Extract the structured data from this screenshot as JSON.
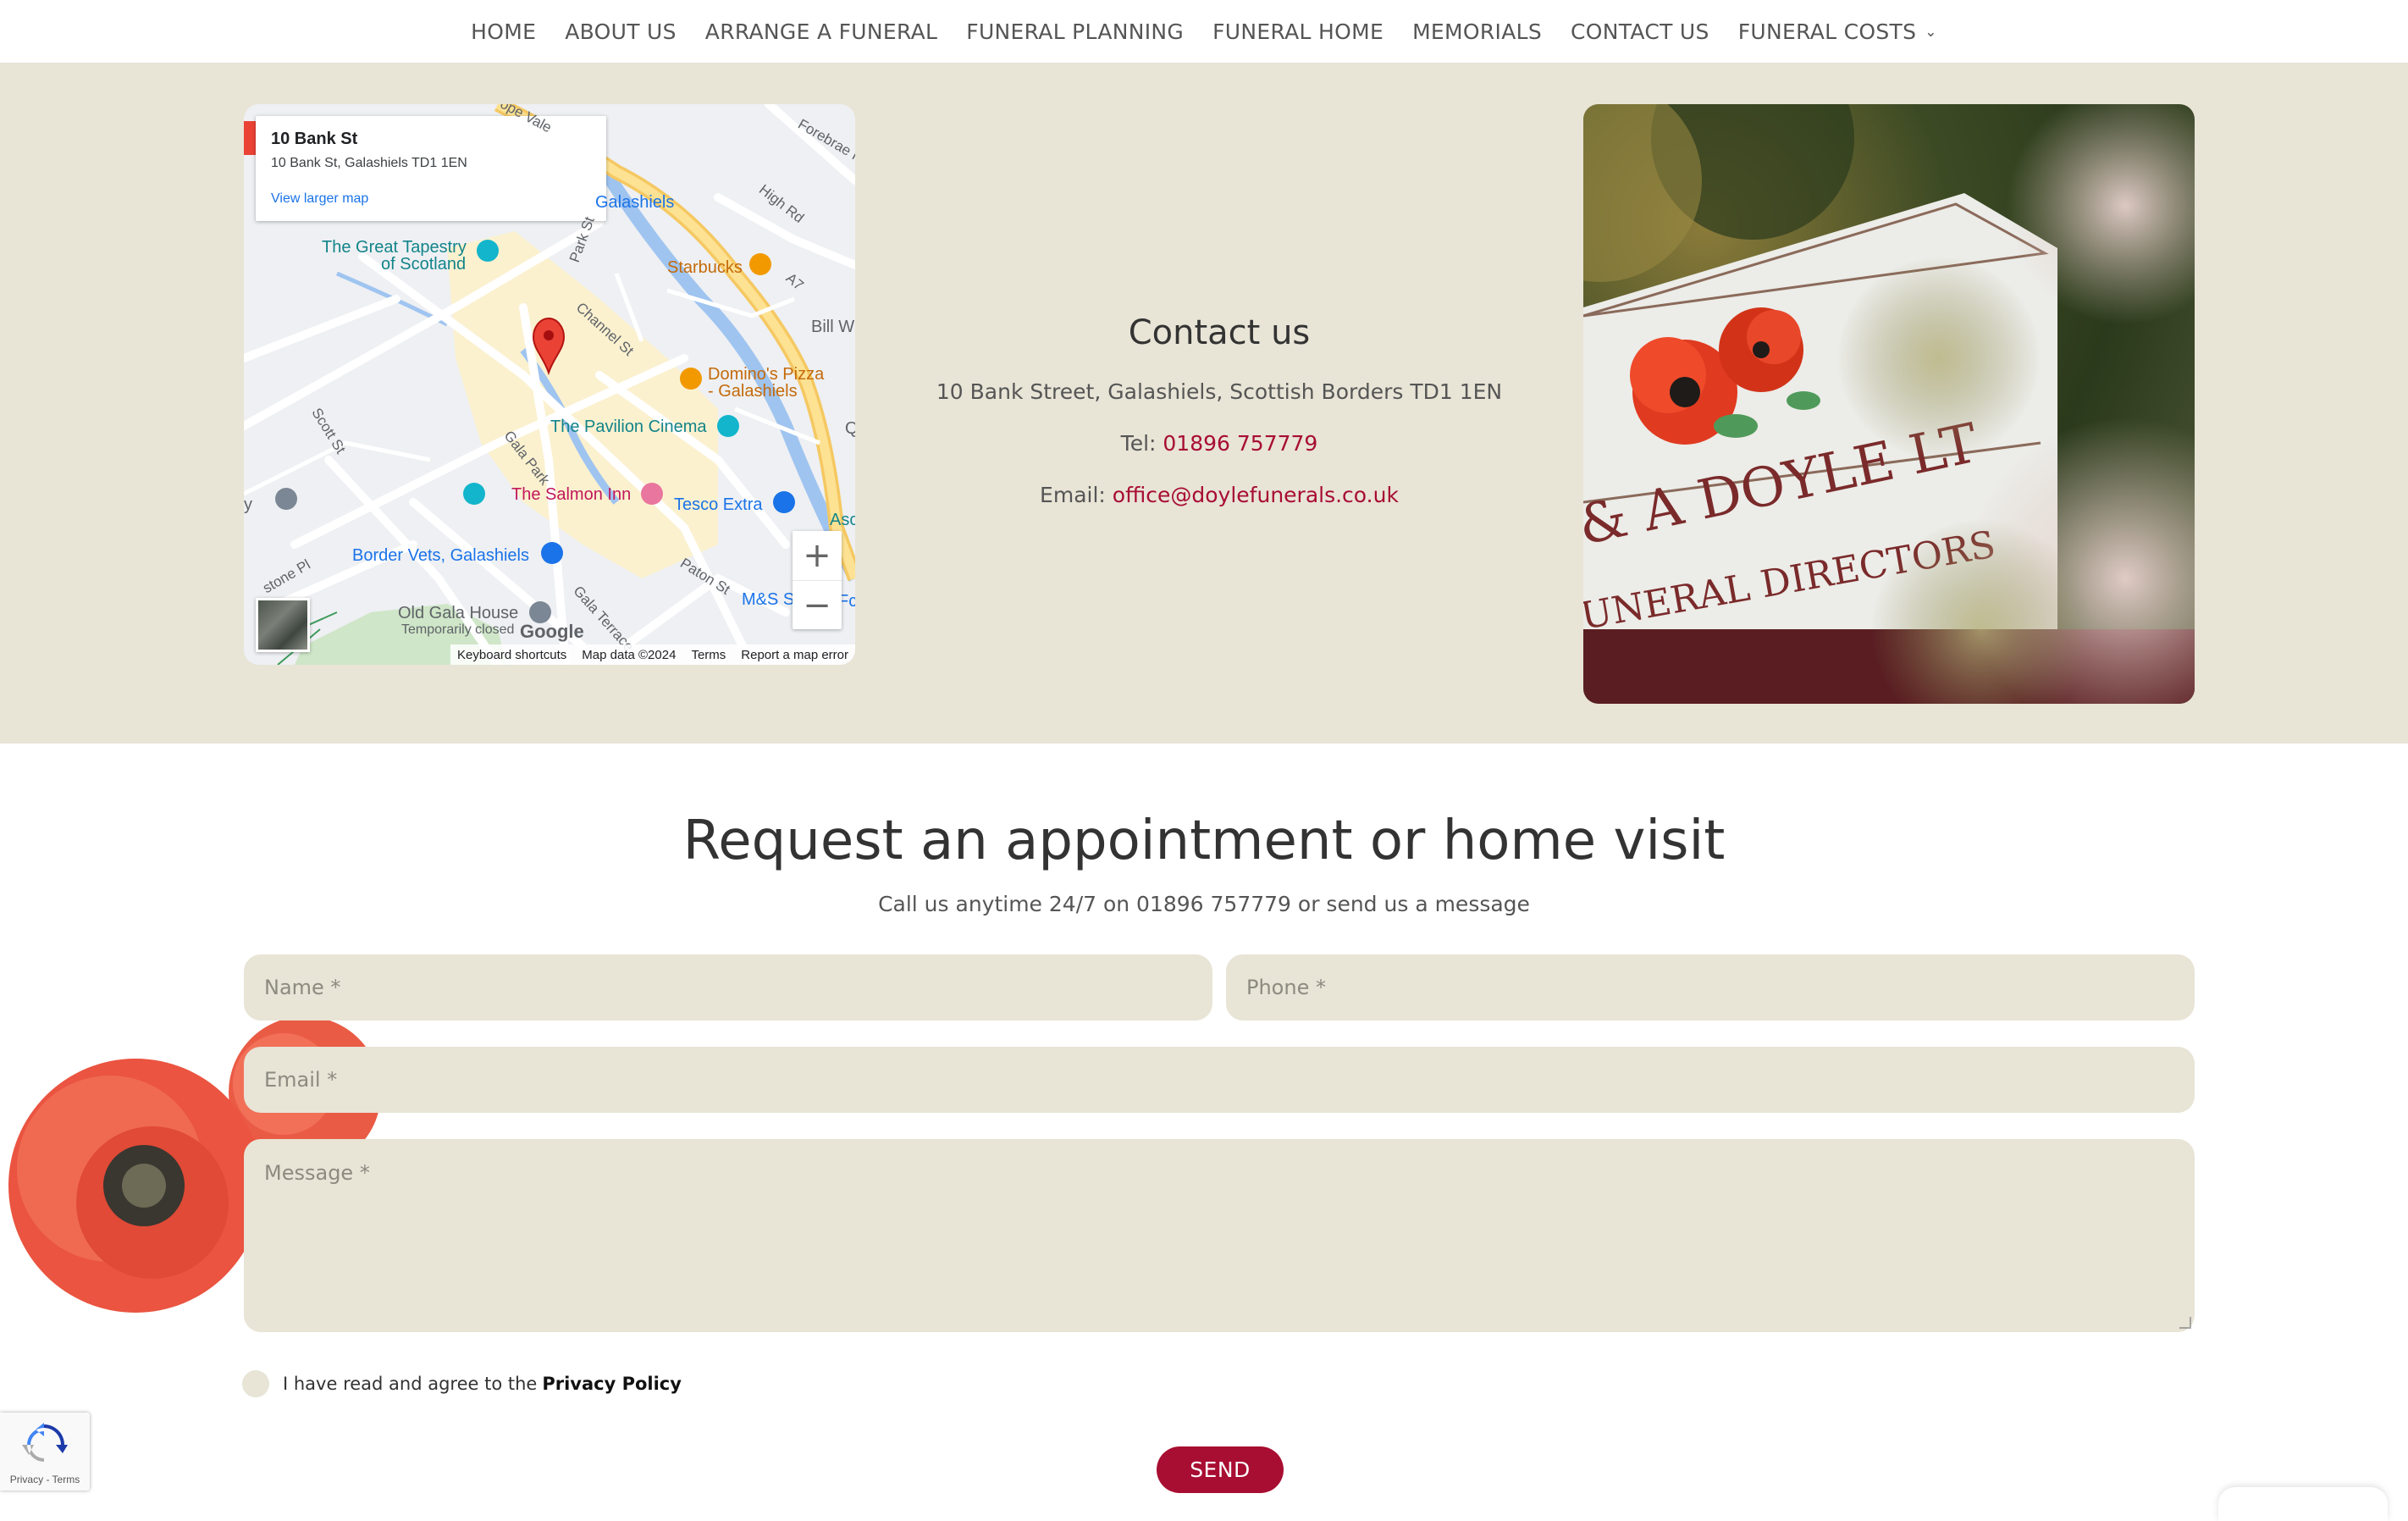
{
  "nav": {
    "items": [
      {
        "label": "HOME"
      },
      {
        "label": "ABOUT US"
      },
      {
        "label": "ARRANGE A FUNERAL"
      },
      {
        "label": "FUNERAL PLANNING"
      },
      {
        "label": "FUNERAL HOME"
      },
      {
        "label": "MEMORIALS"
      },
      {
        "label": "CONTACT US"
      },
      {
        "label": "FUNERAL COSTS"
      }
    ],
    "dropdown_icon": "chevron-down-icon"
  },
  "map": {
    "card": {
      "title": "10 Bank St",
      "address": "10 Bank St, Galashiels TD1 1EN",
      "link": "View larger map"
    },
    "labels": {
      "galashiels": "Galashiels",
      "tapestry_1": "The Great Tapestry",
      "tapestry_2": "of Scotland",
      "starbucks": "Starbucks",
      "dominos_1": "Domino's Pizza",
      "dominos_2": "- Galashiels",
      "pavilion": "The Pavilion Cinema",
      "salmon": "The Salmon Inn",
      "tesco": "Tesco Extra",
      "border_vets": "Border Vets, Galashiels",
      "old_gala_1": "Old Gala House",
      "old_gala_2": "Temporarily closed",
      "ms": "M&S S",
      "bill_w": "Bill W",
      "forebrae": "Forebrae H",
      "high_rd": "High Rd",
      "a7": "A7",
      "hope_vale": "ope Vale",
      "park_st": "Park St",
      "channel_st": "Channel St",
      "scott_st": "Scott St",
      "gala_park": "Gala Park",
      "paton_st": "Paton St",
      "gala_terrace": "Gala Terrace",
      "elmstone_pl": "stone Pl",
      "asc": "Asc",
      "q": "Q",
      "fc": "Fc",
      "y": "y"
    },
    "zoom_in": "+",
    "zoom_out": "−",
    "google": "Google",
    "attribution": [
      "Keyboard shortcuts",
      "Map data ©2024",
      "Terms",
      "Report a map error"
    ]
  },
  "contact": {
    "title": "Contact us",
    "address": "10 Bank Street, Galashiels, Scottish Borders TD1 1EN",
    "tel_label": "Tel:",
    "tel": "01896 757779",
    "email_label": "Email:",
    "email": "office@doylefunerals.co.uk"
  },
  "photo": {
    "sign_line1": "& A DOYLE LT",
    "sign_line2": "UNERAL DIRECTORS"
  },
  "appointment": {
    "title": "Request an appointment or home visit",
    "subtitle": "Call us anytime 24/7 on 01896 757779 or send us a message",
    "fields": {
      "name_placeholder": "Name *",
      "phone_placeholder": "Phone *",
      "email_placeholder": "Email *",
      "message_placeholder": "Message *"
    },
    "privacy_text": "I have read and agree to the",
    "privacy_link": "Privacy Policy",
    "send": "SEND"
  },
  "recaptcha": {
    "text": "Privacy - Terms"
  },
  "colors": {
    "accent": "#a80d32",
    "band": "#e8e4d6"
  }
}
